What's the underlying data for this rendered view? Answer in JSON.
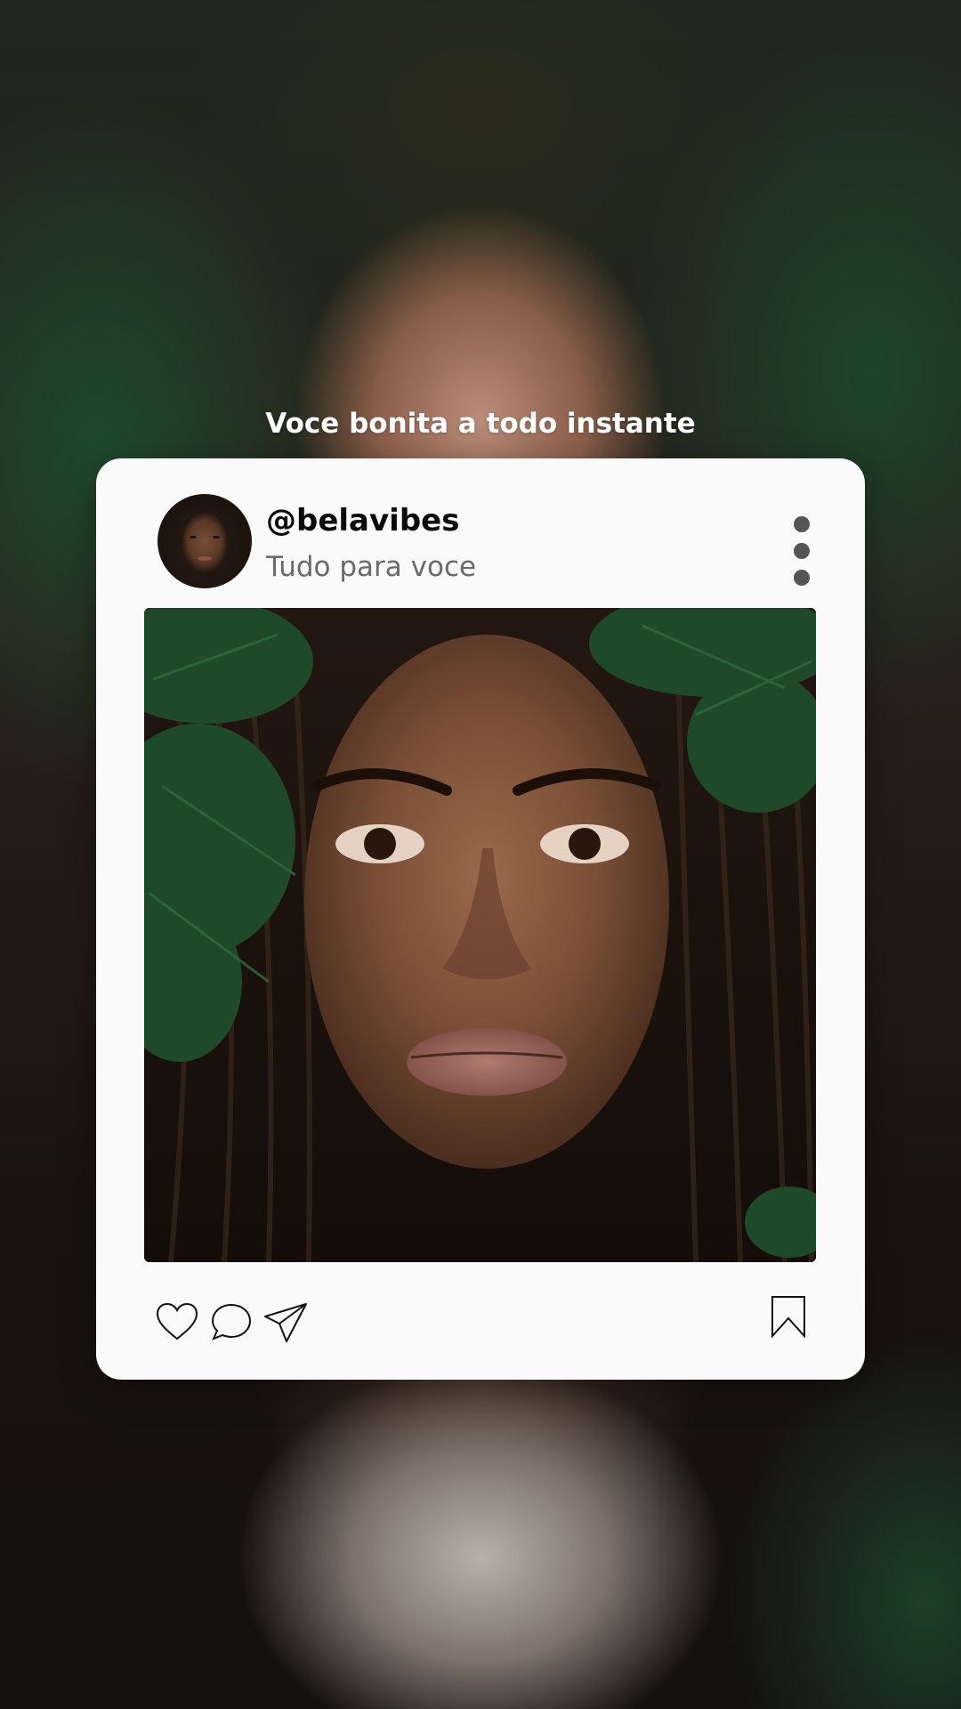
{
  "headline": "Voce bonita a todo instante",
  "post": {
    "username": "@belavibes",
    "subtitle": "Tudo para voce",
    "avatar_icon": "profile-photo",
    "more_icon": "vertical-ellipsis-icon",
    "image_description_icon": "portrait-photo"
  },
  "actions": {
    "like_icon": "heart-icon",
    "comment_icon": "comment-bubble-icon",
    "share_icon": "paper-plane-icon",
    "save_icon": "bookmark-icon"
  },
  "colors": {
    "card": "#fafafa",
    "username": "#0a0a0a",
    "subtitle": "#6a6a6a",
    "more_dots": "#555555",
    "headline": "#ffffff"
  }
}
